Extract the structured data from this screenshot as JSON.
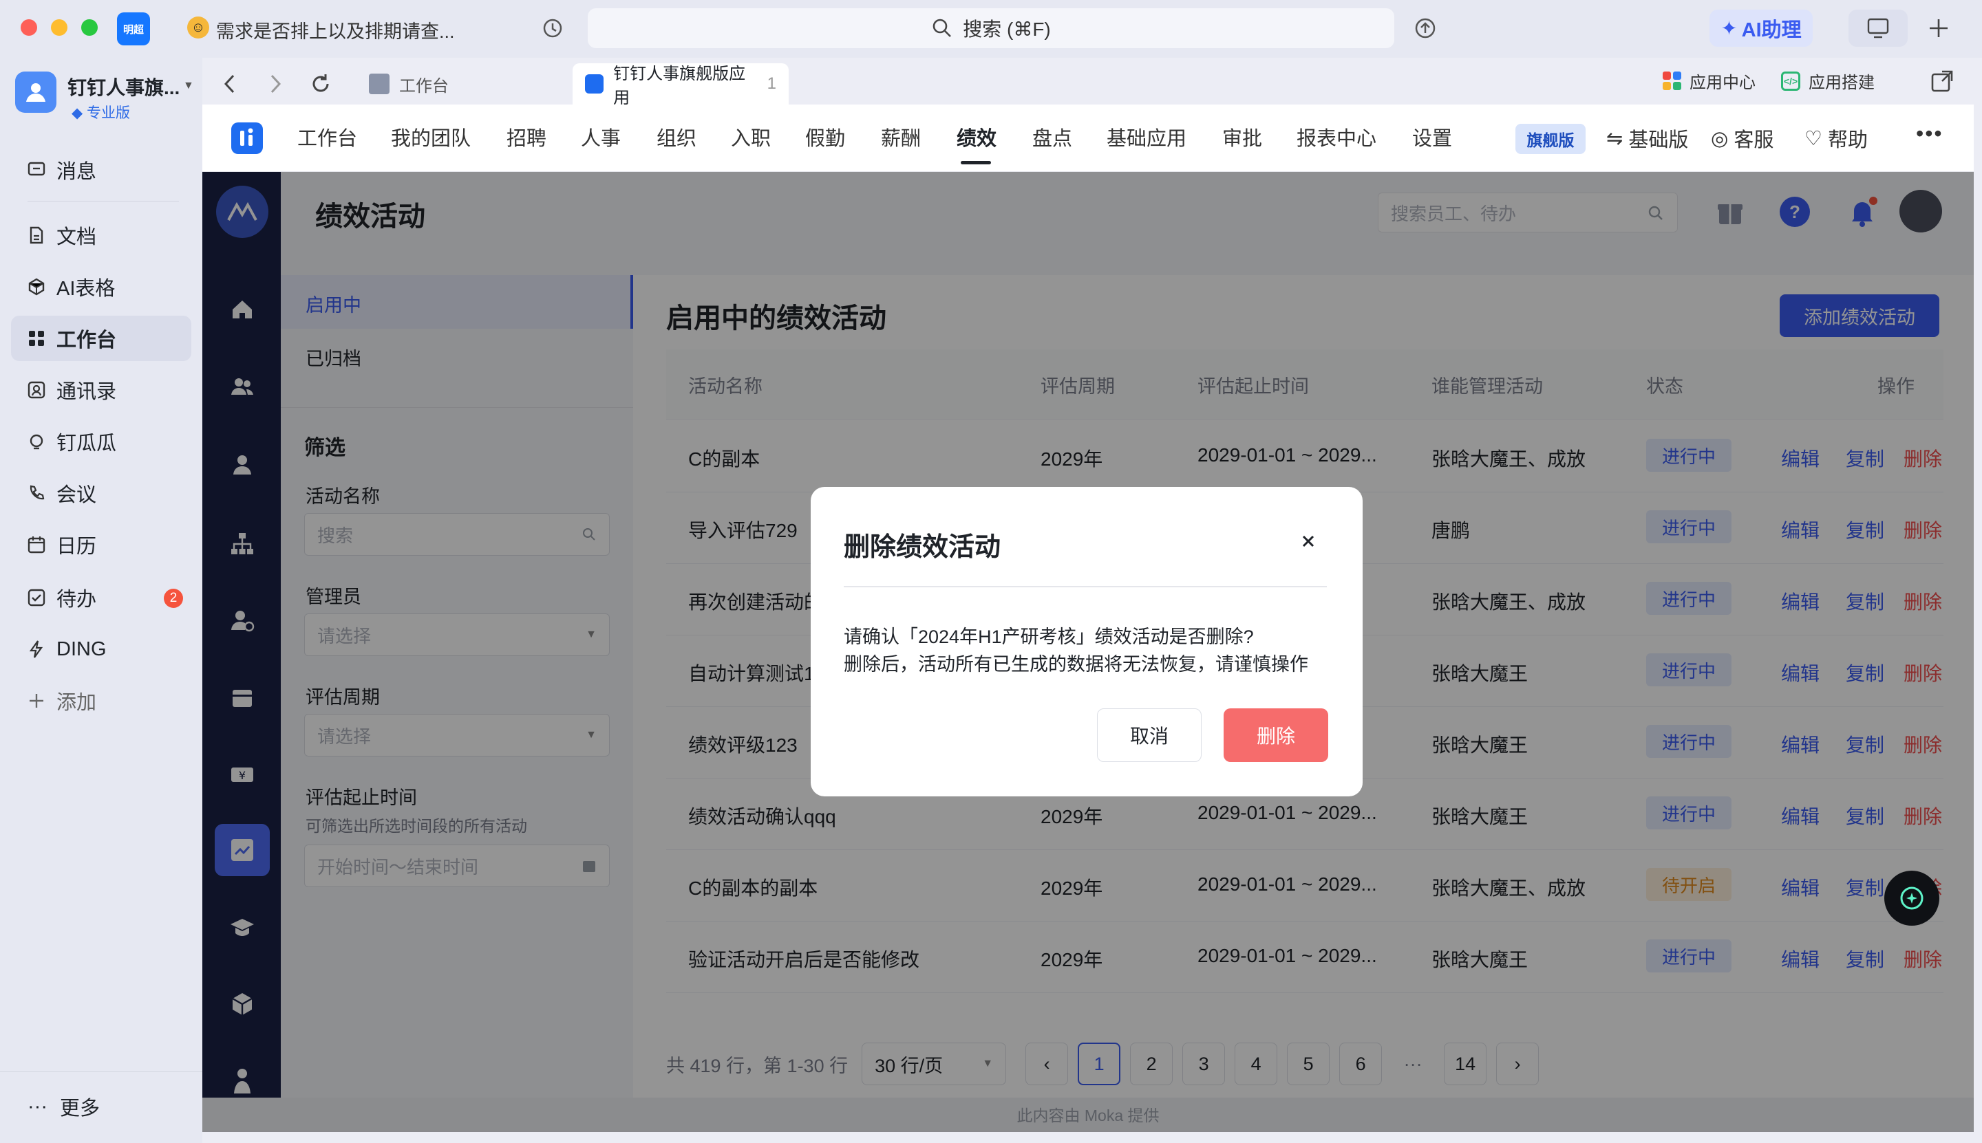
{
  "titlebar": {
    "badge": "明超",
    "tab_title": "需求是否排上以及排期请查...",
    "search": "搜索 (⌘F)",
    "ai_label": "AI助理"
  },
  "sidebar": {
    "org_name": "钉钉人事旗...",
    "org_tag": "专业版",
    "items": [
      {
        "label": "消息",
        "icon": "chat-icon"
      },
      {
        "label": "文档",
        "icon": "doc-icon"
      },
      {
        "label": "AI表格",
        "icon": "ai-table-icon"
      },
      {
        "label": "工作台",
        "icon": "grid-icon",
        "active": true
      },
      {
        "label": "通讯录",
        "icon": "contacts-icon"
      },
      {
        "label": "钉瓜瓜",
        "icon": "bulb-icon"
      },
      {
        "label": "会议",
        "icon": "phone-icon"
      },
      {
        "label": "日历",
        "icon": "calendar-icon"
      },
      {
        "label": "待办",
        "icon": "check-icon",
        "badge": "2"
      },
      {
        "label": "DING",
        "icon": "lightning-icon"
      },
      {
        "label": "添加",
        "icon": "plus-icon"
      }
    ],
    "more": "更多"
  },
  "tabs": {
    "tab1": "工作台",
    "tab2": "钉钉人事旗舰版应用",
    "tab2_suffix": "1",
    "app_center": "应用中心",
    "app_build": "应用搭建"
  },
  "app_menu": {
    "items": [
      "工作台",
      "我的团队",
      "招聘",
      "人事",
      "组织",
      "入职",
      "假勤",
      "薪酬",
      "绩效",
      "盘点",
      "基础应用",
      "审批",
      "报表中心",
      "设置"
    ],
    "active": "绩效",
    "version": "旗舰版",
    "basic": "基础版",
    "service": "客服",
    "help": "帮助"
  },
  "moka": {
    "page_title": "绩效活动",
    "search_placeholder": "搜索员工、待办",
    "filter": {
      "tab_active": "启用中",
      "tab_archived": "已归档",
      "heading": "筛选",
      "name_label": "活动名称",
      "name_placeholder": "搜索",
      "admin_label": "管理员",
      "admin_placeholder": "请选择",
      "cycle_label": "评估周期",
      "cycle_placeholder": "请选择",
      "time_label": "评估起止时间",
      "time_hint": "可筛选出所选时间段的所有活动",
      "time_placeholder": "开始时间～结束时间"
    },
    "section_title": "启用中的绩效活动",
    "add_button": "添加绩效活动",
    "columns": [
      "活动名称",
      "评估周期",
      "评估起止时间",
      "谁能管理活动",
      "状态",
      "操作"
    ],
    "rows": [
      {
        "name": "C的副本",
        "cycle": "2029年",
        "time": "2029-01-01 ~ 2029...",
        "admins": "张晗大魔王、成放",
        "status": "进行中"
      },
      {
        "name": "导入评估729",
        "cycle": "",
        "time": "...9...",
        "admins": "唐鹏",
        "status": "进行中"
      },
      {
        "name": "再次创建活动的",
        "cycle": "",
        "time": "...9...",
        "admins": "张晗大魔王、成放",
        "status": "进行中"
      },
      {
        "name": "自动计算测试1",
        "cycle": "",
        "time": "...9...",
        "admins": "张晗大魔王",
        "status": "进行中"
      },
      {
        "name": "绩效评级123",
        "cycle": "",
        "time": "...9...",
        "admins": "张晗大魔王",
        "status": "进行中"
      },
      {
        "name": "绩效活动确认qqq",
        "cycle": "2029年",
        "time": "2029-01-01 ~ 2029...",
        "admins": "张晗大魔王",
        "status": "进行中"
      },
      {
        "name": "C的副本的副本",
        "cycle": "2029年",
        "time": "2029-01-01 ~ 2029...",
        "admins": "张晗大魔王、成放",
        "status": "待开启"
      },
      {
        "name": "验证活动开启后是否能修改",
        "cycle": "2029年",
        "time": "2029-01-01 ~ 2029...",
        "admins": "张晗大魔王",
        "status": "进行中"
      }
    ],
    "actions": {
      "edit": "编辑",
      "copy": "复制",
      "delete": "删除"
    },
    "pager": {
      "summary": "共 419 行，第 1-30 行",
      "page_size": "30 行/页",
      "pages": [
        "1",
        "2",
        "3",
        "4",
        "5",
        "6",
        "···",
        "14"
      ],
      "current": "1"
    },
    "footer": "此内容由 Moka 提供"
  },
  "modal": {
    "title": "删除绩效活动",
    "line1": "请确认「2024年H1产研考核」绩效活动是否删除?",
    "line2": "删除后，活动所有已生成的数据将无法恢复，请谨慎操作",
    "cancel": "取消",
    "confirm": "删除"
  },
  "colors": {
    "accent": "#3b5cf0",
    "danger": "#f66c6c",
    "moka_sidebar": "#1b2245",
    "status_running_bg": "#e6ecfd",
    "status_pending_bg": "#fdf0dc"
  }
}
